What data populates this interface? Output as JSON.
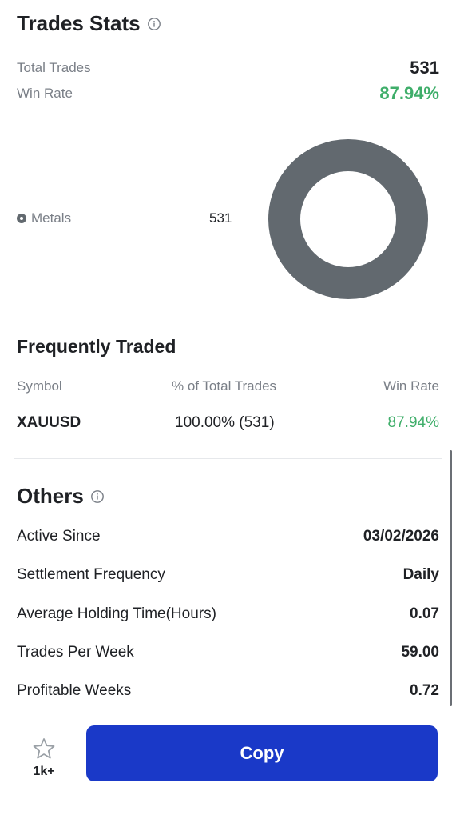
{
  "trades_stats": {
    "title": "Trades Stats",
    "info_icon": "info-circle-icon",
    "total_trades_label": "Total Trades",
    "total_trades_value": "531",
    "win_rate_label": "Win Rate",
    "win_rate_value": "87.94%"
  },
  "chart_data": {
    "type": "pie",
    "style": "donut",
    "categories": [
      "Metals"
    ],
    "values": [
      531
    ],
    "colors": [
      "#62696f"
    ],
    "legend_placement": "left"
  },
  "legend": {
    "label": "Metals",
    "count": "531"
  },
  "frequently_traded": {
    "title": "Frequently Traded",
    "columns": [
      "Symbol",
      "% of Total Trades",
      "Win Rate"
    ],
    "rows": [
      {
        "symbol": "XAUUSD",
        "percent": "100.00% (531)",
        "win_rate": "87.94%"
      }
    ]
  },
  "others": {
    "title": "Others",
    "info_icon": "info-circle-icon",
    "rows": [
      {
        "label": "Active Since",
        "value": "03/02/2026"
      },
      {
        "label": "Settlement Frequency",
        "value": "Daily"
      },
      {
        "label": "Average Holding Time(Hours)",
        "value": "0.07"
      },
      {
        "label": "Trades Per Week",
        "value": "59.00"
      },
      {
        "label": "Profitable Weeks",
        "value": "0.72"
      }
    ]
  },
  "bottom_bar": {
    "favorite_icon": "star-outline-icon",
    "favorite_count": "1k+",
    "copy_label": "Copy"
  },
  "colors": {
    "accent_blue": "#1a39c8",
    "positive_green": "#3fae6a",
    "donut_gray": "#62696f"
  }
}
